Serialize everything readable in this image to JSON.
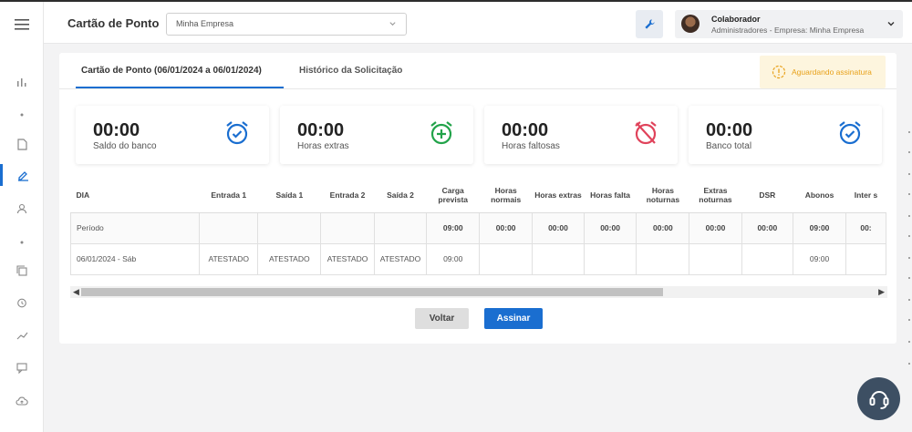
{
  "header": {
    "app_title": "Cartão de Ponto",
    "company_select": "Minha Empresa",
    "user_name": "Colaborador",
    "user_role": "Administradores - Empresa: Minha Empresa"
  },
  "tabs": [
    {
      "label": "Cartão de Ponto (06/01/2024 a 06/01/2024)",
      "active": true
    },
    {
      "label": "Histórico da Solicitação",
      "active": false
    }
  ],
  "sign_status": "Aguardando assinatura",
  "stats": [
    {
      "value": "00:00",
      "label": "Saldo do banco",
      "icon": "alarm-check-icon",
      "color": "#1a6ed0"
    },
    {
      "value": "00:00",
      "label": "Horas extras",
      "icon": "alarm-plus-icon",
      "color": "#22a34a"
    },
    {
      "value": "00:00",
      "label": "Horas faltosas",
      "icon": "alarm-off-icon",
      "color": "#e0435b"
    },
    {
      "value": "00:00",
      "label": "Banco total",
      "icon": "alarm-check-icon",
      "color": "#1a6ed0"
    }
  ],
  "table": {
    "headers": [
      "DIA",
      "Entrada 1",
      "Saída 1",
      "Entrada 2",
      "Saída 2",
      "Carga prevista",
      "Horas normais",
      "Horas extras",
      "Horas falta",
      "Horas noturnas",
      "Extras noturnas",
      "DSR",
      "Abonos",
      "Inter s"
    ],
    "period_row": [
      "Período",
      "",
      "",
      "",
      "",
      "09:00",
      "00:00",
      "00:00",
      "00:00",
      "00:00",
      "00:00",
      "00:00",
      "09:00",
      "00:"
    ],
    "rows": [
      [
        "06/01/2024 - Sáb",
        "ATESTADO",
        "ATESTADO",
        "ATESTADO",
        "ATESTADO",
        "09:00",
        "",
        "",
        "",
        "",
        "",
        "",
        "09:00",
        ""
      ]
    ]
  },
  "buttons": {
    "back": "Voltar",
    "sign": "Assinar"
  }
}
